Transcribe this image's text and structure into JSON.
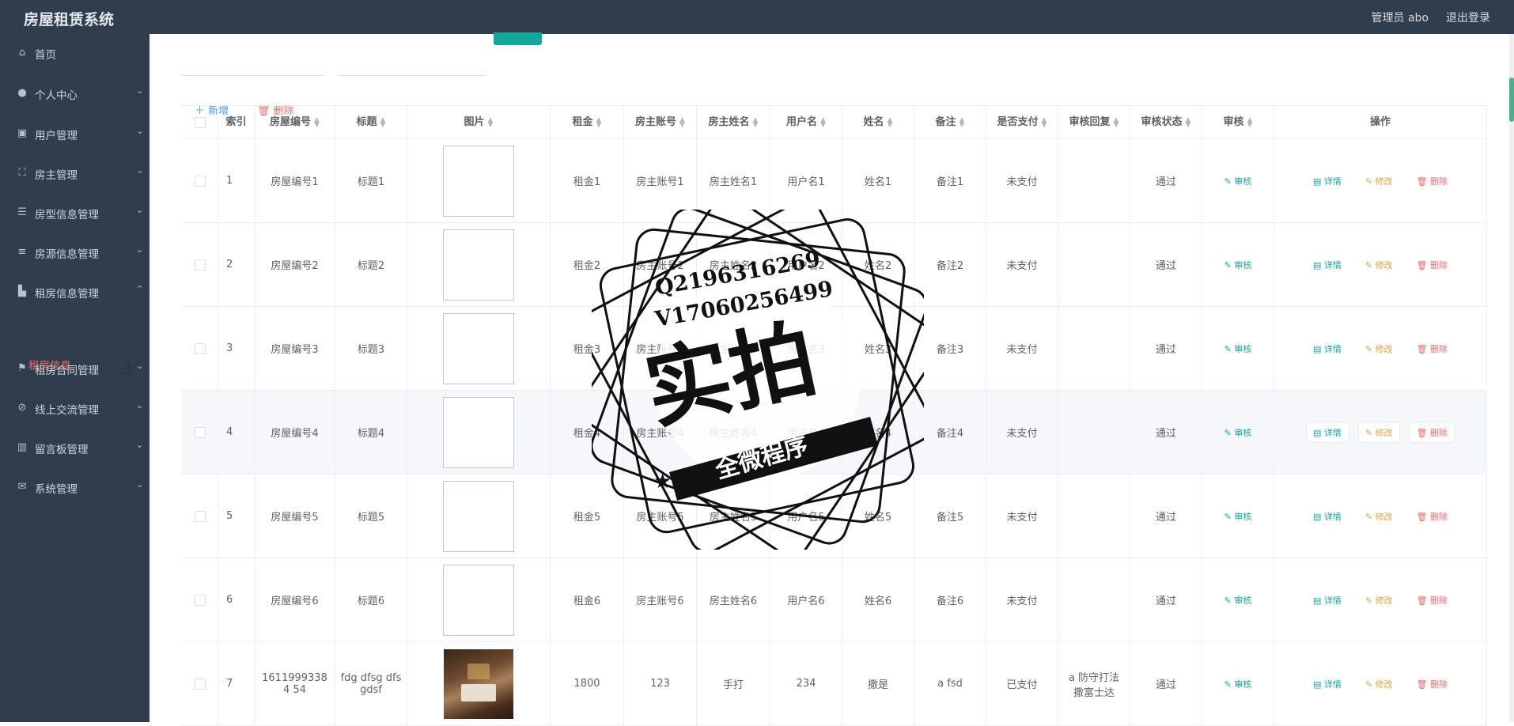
{
  "app": {
    "title": "房屋租赁系统",
    "user": "管理员 abo",
    "logout": "退出登录"
  },
  "sidebar": {
    "items": [
      {
        "label": "首页",
        "icon": "home-icon"
      },
      {
        "label": "个人中心",
        "icon": "user-icon"
      },
      {
        "label": "用户管理",
        "icon": "user-manage-icon"
      },
      {
        "label": "房主管理",
        "icon": "scan-icon"
      },
      {
        "label": "房型信息管理",
        "icon": "sliders-icon"
      },
      {
        "label": "房源信息管理",
        "icon": "list-icon"
      },
      {
        "label": "租房信息管理",
        "icon": "thumb-icon"
      },
      {
        "label": "租房合同管理",
        "icon": "flag-icon"
      },
      {
        "label": "线上交流管理",
        "icon": "chat-icon"
      },
      {
        "label": "留言板管理",
        "icon": "board-icon"
      },
      {
        "label": "系统管理",
        "icon": "mail-icon"
      }
    ],
    "sub_active": "租房信息"
  },
  "toolbar": {
    "add_label": "新增",
    "delete_label": "删除"
  },
  "table": {
    "headers": [
      "索引",
      "房屋编号",
      "标题",
      "图片",
      "租金",
      "房主账号",
      "房主姓名",
      "用户名",
      "姓名",
      "备注",
      "是否支付",
      "审核回复",
      "审核状态",
      "审核",
      "操作"
    ],
    "rows": [
      {
        "idx": "1",
        "code": "房屋编号1",
        "title": "标题1",
        "rent": "租金1",
        "owner_acc": "房主账号1",
        "owner_name": "房主姓名1",
        "username": "用户名1",
        "name": "姓名1",
        "note": "备注1",
        "paid": "未支付",
        "reply": "",
        "status": "通过"
      },
      {
        "idx": "2",
        "code": "房屋编号2",
        "title": "标题2",
        "rent": "租金2",
        "owner_acc": "房主账号2",
        "owner_name": "房主姓名2",
        "username": "用户名2",
        "name": "姓名2",
        "note": "备注2",
        "paid": "未支付",
        "reply": "",
        "status": "通过"
      },
      {
        "idx": "3",
        "code": "房屋编号3",
        "title": "标题3",
        "rent": "租金3",
        "owner_acc": "房主账号3",
        "owner_name": "房主姓名3",
        "username": "用户名3",
        "name": "姓名3",
        "note": "备注3",
        "paid": "未支付",
        "reply": "",
        "status": "通过"
      },
      {
        "idx": "4",
        "code": "房屋编号4",
        "title": "标题4",
        "rent": "租金4",
        "owner_acc": "房主账号4",
        "owner_name": "房主姓名4",
        "username": "用户名4",
        "name": "姓名4",
        "note": "备注4",
        "paid": "未支付",
        "reply": "",
        "status": "通过"
      },
      {
        "idx": "5",
        "code": "房屋编号5",
        "title": "标题5",
        "rent": "租金5",
        "owner_acc": "房主账号5",
        "owner_name": "房主姓名5",
        "username": "用户名5",
        "name": "姓名5",
        "note": "备注5",
        "paid": "未支付",
        "reply": "",
        "status": "通过"
      },
      {
        "idx": "6",
        "code": "房屋编号6",
        "title": "标题6",
        "rent": "租金6",
        "owner_acc": "房主账号6",
        "owner_name": "房主姓名6",
        "username": "用户名6",
        "name": "姓名6",
        "note": "备注6",
        "paid": "未支付",
        "reply": "",
        "status": "通过"
      },
      {
        "idx": "7",
        "code": "16119993384 54",
        "title": "fdg dfsg dfs gdsf",
        "rent": "1800",
        "owner_acc": "123",
        "owner_name": "手打",
        "username": "234",
        "name": "撒是",
        "note": "a fsd",
        "paid": "已支付",
        "reply": "a 防守打法 撒富士达",
        "status": "通过"
      }
    ],
    "audit_label": "审核",
    "detail_label": "详情",
    "edit_label": "修改",
    "del_label": "删除"
  },
  "watermark": {
    "line1": "Q2196316269",
    "line2": "V17060256499",
    "big": "实拍",
    "banner": "全微程序"
  }
}
